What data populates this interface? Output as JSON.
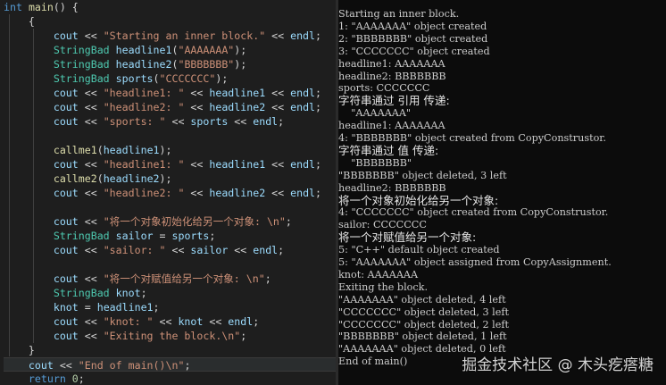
{
  "editor": {
    "lines": [
      [
        [
          "kw",
          "int"
        ],
        [
          "op",
          " "
        ],
        [
          "fn",
          "main"
        ],
        [
          "op",
          "() {"
        ]
      ],
      [
        [
          "op",
          "    {"
        ]
      ],
      [
        [
          "op",
          "        "
        ],
        [
          "var",
          "cout"
        ],
        [
          "op",
          " << "
        ],
        [
          "str",
          "\"Starting an inner block.\""
        ],
        [
          "op",
          " << "
        ],
        [
          "var",
          "endl"
        ],
        [
          "op",
          ";"
        ]
      ],
      [
        [
          "op",
          "        "
        ],
        [
          "ty",
          "StringBad"
        ],
        [
          "op",
          " "
        ],
        [
          "var",
          "headline1"
        ],
        [
          "op",
          "("
        ],
        [
          "str",
          "\"AAAAAAA\""
        ],
        [
          "op",
          ");"
        ]
      ],
      [
        [
          "op",
          "        "
        ],
        [
          "ty",
          "StringBad"
        ],
        [
          "op",
          " "
        ],
        [
          "var",
          "headline2"
        ],
        [
          "op",
          "("
        ],
        [
          "str",
          "\"BBBBBBB\""
        ],
        [
          "op",
          ");"
        ]
      ],
      [
        [
          "op",
          "        "
        ],
        [
          "ty",
          "StringBad"
        ],
        [
          "op",
          " "
        ],
        [
          "var",
          "sports"
        ],
        [
          "op",
          "("
        ],
        [
          "str",
          "\"CCCCCCC\""
        ],
        [
          "op",
          ");"
        ]
      ],
      [
        [
          "op",
          "        "
        ],
        [
          "var",
          "cout"
        ],
        [
          "op",
          " << "
        ],
        [
          "str",
          "\"headline1: \""
        ],
        [
          "op",
          " << "
        ],
        [
          "var",
          "headline1"
        ],
        [
          "op",
          " << "
        ],
        [
          "var",
          "endl"
        ],
        [
          "op",
          ";"
        ]
      ],
      [
        [
          "op",
          "        "
        ],
        [
          "var",
          "cout"
        ],
        [
          "op",
          " << "
        ],
        [
          "str",
          "\"headline2: \""
        ],
        [
          "op",
          " << "
        ],
        [
          "var",
          "headline2"
        ],
        [
          "op",
          " << "
        ],
        [
          "var",
          "endl"
        ],
        [
          "op",
          ";"
        ]
      ],
      [
        [
          "op",
          "        "
        ],
        [
          "var",
          "cout"
        ],
        [
          "op",
          " << "
        ],
        [
          "str",
          "\"sports: \""
        ],
        [
          "op",
          " << "
        ],
        [
          "var",
          "sports"
        ],
        [
          "op",
          " << "
        ],
        [
          "var",
          "endl"
        ],
        [
          "op",
          ";"
        ]
      ],
      [
        [
          "op",
          ""
        ]
      ],
      [
        [
          "op",
          "        "
        ],
        [
          "fn",
          "callme1"
        ],
        [
          "op",
          "("
        ],
        [
          "var",
          "headline1"
        ],
        [
          "op",
          ");"
        ]
      ],
      [
        [
          "op",
          "        "
        ],
        [
          "var",
          "cout"
        ],
        [
          "op",
          " << "
        ],
        [
          "str",
          "\"headline1: \""
        ],
        [
          "op",
          " << "
        ],
        [
          "var",
          "headline1"
        ],
        [
          "op",
          " << "
        ],
        [
          "var",
          "endl"
        ],
        [
          "op",
          ";"
        ]
      ],
      [
        [
          "op",
          "        "
        ],
        [
          "fn",
          "callme2"
        ],
        [
          "op",
          "("
        ],
        [
          "var",
          "headline2"
        ],
        [
          "op",
          ");"
        ]
      ],
      [
        [
          "op",
          "        "
        ],
        [
          "var",
          "cout"
        ],
        [
          "op",
          " << "
        ],
        [
          "str",
          "\"headline2: \""
        ],
        [
          "op",
          " << "
        ],
        [
          "var",
          "headline2"
        ],
        [
          "op",
          " << "
        ],
        [
          "var",
          "endl"
        ],
        [
          "op",
          ";"
        ]
      ],
      [
        [
          "op",
          ""
        ]
      ],
      [
        [
          "op",
          "        "
        ],
        [
          "var",
          "cout"
        ],
        [
          "op",
          " << "
        ],
        [
          "str",
          "\"将一个对象初始化给另一个对象: \\n\""
        ],
        [
          "op",
          ";"
        ]
      ],
      [
        [
          "op",
          "        "
        ],
        [
          "ty",
          "StringBad"
        ],
        [
          "op",
          " "
        ],
        [
          "var",
          "sailor"
        ],
        [
          "op",
          " = "
        ],
        [
          "var",
          "sports"
        ],
        [
          "op",
          ";"
        ]
      ],
      [
        [
          "op",
          "        "
        ],
        [
          "var",
          "cout"
        ],
        [
          "op",
          " << "
        ],
        [
          "str",
          "\"sailor: \""
        ],
        [
          "op",
          " << "
        ],
        [
          "var",
          "sailor"
        ],
        [
          "op",
          " << "
        ],
        [
          "var",
          "endl"
        ],
        [
          "op",
          ";"
        ]
      ],
      [
        [
          "op",
          ""
        ]
      ],
      [
        [
          "op",
          "        "
        ],
        [
          "var",
          "cout"
        ],
        [
          "op",
          " << "
        ],
        [
          "str",
          "\"将一个对赋值给另一个对象: \\n\""
        ],
        [
          "op",
          ";"
        ]
      ],
      [
        [
          "op",
          "        "
        ],
        [
          "ty",
          "StringBad"
        ],
        [
          "op",
          " "
        ],
        [
          "var",
          "knot"
        ],
        [
          "op",
          ";"
        ]
      ],
      [
        [
          "op",
          "        "
        ],
        [
          "var",
          "knot"
        ],
        [
          "op",
          " = "
        ],
        [
          "var",
          "headline1"
        ],
        [
          "op",
          ";"
        ]
      ],
      [
        [
          "op",
          "        "
        ],
        [
          "var",
          "cout"
        ],
        [
          "op",
          " << "
        ],
        [
          "str",
          "\"knot: \""
        ],
        [
          "op",
          " << "
        ],
        [
          "var",
          "knot"
        ],
        [
          "op",
          " << "
        ],
        [
          "var",
          "endl"
        ],
        [
          "op",
          ";"
        ]
      ],
      [
        [
          "op",
          "        "
        ],
        [
          "var",
          "cout"
        ],
        [
          "op",
          " << "
        ],
        [
          "str",
          "\"Exiting the block.\\n\""
        ],
        [
          "op",
          ";"
        ]
      ],
      [
        [
          "op",
          "    }"
        ]
      ],
      [
        [
          "op",
          "    "
        ],
        [
          "var",
          "cout"
        ],
        [
          "op",
          " << "
        ],
        [
          "str",
          "\"End of main()\\n\""
        ],
        [
          "op",
          ";"
        ]
      ],
      [
        [
          "op",
          "    "
        ],
        [
          "kw",
          "return"
        ],
        [
          "op",
          " "
        ],
        [
          "num",
          "0"
        ],
        [
          "op",
          ";"
        ]
      ]
    ],
    "active_line": 25
  },
  "console": {
    "lines": [
      "Starting an inner block.",
      "1: \"AAAAAAA\" object created",
      "2: \"BBBBBBB\" object created",
      "3: \"CCCCCCC\" object created",
      "headline1: AAAAAAA",
      "headline2: BBBBBBB",
      "sports: CCCCCCC",
      "字符串通过 引用 传递:",
      "    \"AAAAAAA\"",
      "headline1: AAAAAAA",
      "4: \"BBBBBBB\" object created from CopyConstrustor.",
      "字符串通过 值 传递:",
      "    \"BBBBBBB\"",
      "\"BBBBBBB\" object deleted, 3 left",
      "headline2: BBBBBBB",
      "将一个对象初始化给另一个对象:",
      "4: \"CCCCCCC\" object created from CopyConstrustor.",
      "sailor: CCCCCCC",
      "将一个对赋值给另一个对象:",
      "5: \"C++\" default object created",
      "5: \"AAAAAAA\" object assigned from CopyAssignment.",
      "knot: AAAAAAA",
      "Exiting the block.",
      "\"AAAAAAA\" object deleted, 4 left",
      "\"CCCCCCC\" object deleted, 3 left",
      "\"CCCCCCC\" object deleted, 2 left",
      "\"BBBBBBB\" object deleted, 1 left",
      "\"AAAAAAA\" object deleted, 0 left",
      "End of main()"
    ]
  },
  "watermark": "掘金技术社区 @ 木头疙瘩糖",
  "colors": {
    "editor_bg": "#1e1e1e",
    "console_bg": "#0c0c0c",
    "keyword": "#569cd6",
    "type": "#4ec9b0",
    "function": "#dcdcaa",
    "variable": "#9cdcfe",
    "string": "#ce9178",
    "number": "#b5cea8"
  }
}
